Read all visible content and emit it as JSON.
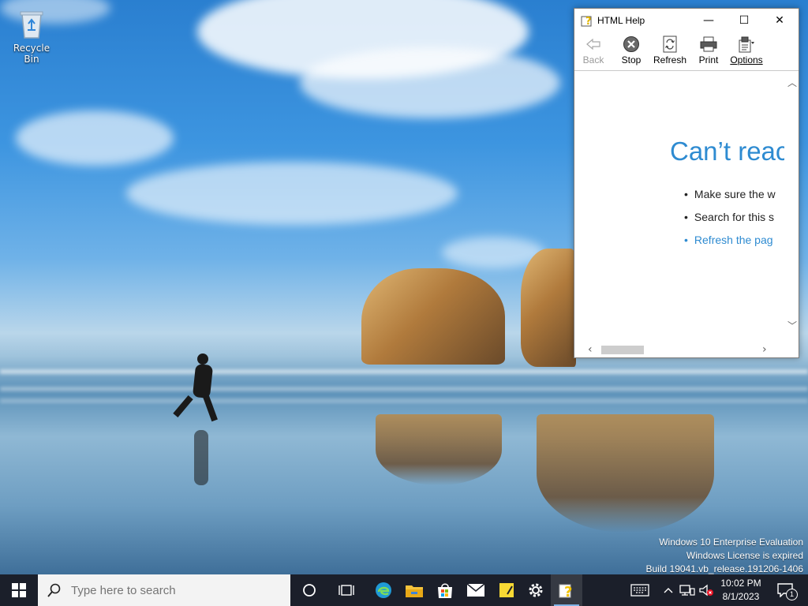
{
  "desktop": {
    "icons": [
      {
        "label": "Recycle Bin",
        "icon": "recycle-bin-icon"
      }
    ],
    "watermark": {
      "line1": "Windows 10 Enterprise Evaluation",
      "line2": "Windows License is expired",
      "line3": "Build 19041.vb_release.191206-1406"
    }
  },
  "help_window": {
    "title": "HTML Help",
    "controls": {
      "minimize": "—",
      "maximize": "☐",
      "close": "✕"
    },
    "toolbar": {
      "back": "Back",
      "stop": "Stop",
      "refresh": "Refresh",
      "print": "Print",
      "options": "Options"
    },
    "content": {
      "heading": "Can’t reac",
      "items": [
        "Make sure the w",
        "Search for this s",
        "Refresh the pag"
      ]
    }
  },
  "taskbar": {
    "search_placeholder": "Type here to search",
    "apps": [
      "cortana-icon",
      "task-view-icon",
      "edge-icon",
      "file-explorer-icon",
      "microsoft-store-icon",
      "mail-icon",
      "sticky-notes-icon",
      "settings-icon",
      "html-help-icon"
    ],
    "clock": {
      "time": "10:02 PM",
      "date": "8/1/2023"
    },
    "notification_count": "1"
  }
}
